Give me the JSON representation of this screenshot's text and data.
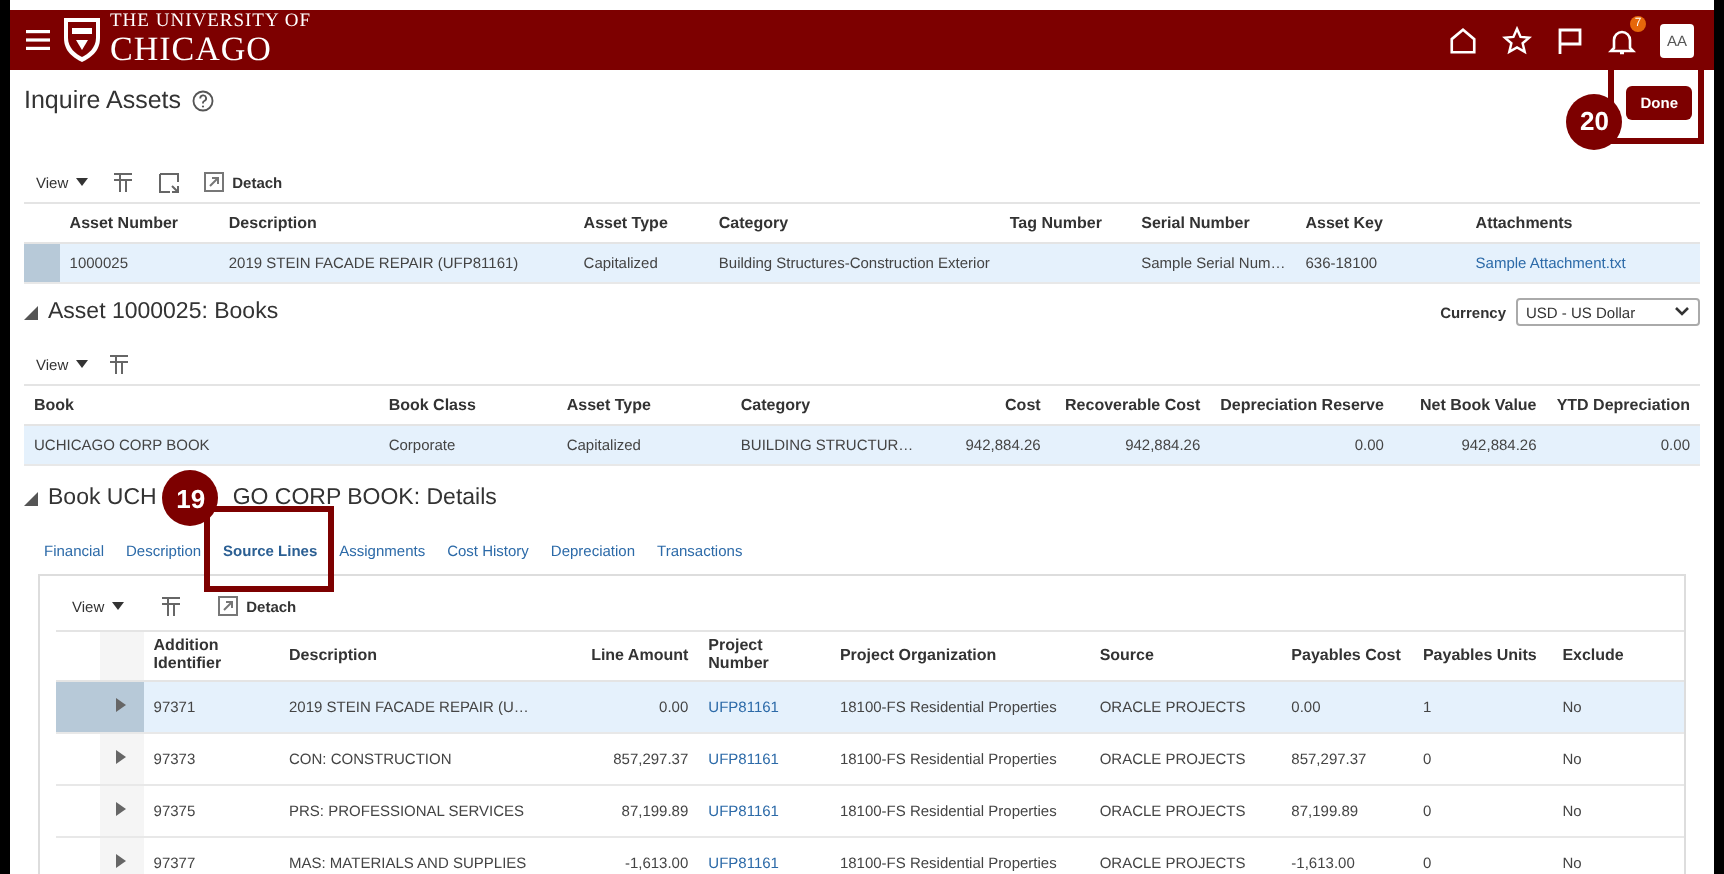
{
  "header": {
    "logo_top": "THE UNIVERSITY OF",
    "logo_bottom": "CHICAGO",
    "notification_count": "7",
    "avatar": "AA"
  },
  "page": {
    "title": "Inquire Assets",
    "done_button": "Done",
    "done_callout": "20"
  },
  "assets_toolbar": {
    "view": "View",
    "detach": "Detach"
  },
  "assets_table": {
    "columns": [
      "Asset Number",
      "Description",
      "Asset Type",
      "Category",
      "Tag Number",
      "Serial Number",
      "Asset Key",
      "Attachments"
    ],
    "rows": [
      {
        "selected": true,
        "cells": [
          "1000025",
          "2019 STEIN FACADE REPAIR (UFP81161)",
          "Capitalized",
          "Building Structures-Construction Exterior",
          "",
          "Sample Serial Num…",
          "636-18100",
          "Sample Attachment.txt"
        ]
      }
    ]
  },
  "books_section": {
    "title": "Asset 1000025: Books",
    "currency_label": "Currency",
    "currency_value": "USD - US Dollar",
    "view": "View"
  },
  "books_table": {
    "columns": [
      "Book",
      "Book Class",
      "Asset Type",
      "Category",
      "Cost",
      "Recoverable Cost",
      "Depreciation Reserve",
      "Net Book Value",
      "YTD Depreciation"
    ],
    "rows": [
      {
        "selected": true,
        "cells": [
          "UCHICAGO CORP BOOK",
          "Corporate",
          "Capitalized",
          "BUILDING STRUCTUR…",
          "942,884.26",
          "942,884.26",
          "0.00",
          "942,884.26",
          "0.00"
        ]
      }
    ]
  },
  "details_section": {
    "title_visible_parts": [
      "Book UCH",
      "GO CORP BOOK: Details"
    ]
  },
  "tabs": [
    {
      "label": "Financial",
      "selected": false
    },
    {
      "label": "Description",
      "selected": false
    },
    {
      "label": "Source Lines",
      "selected": true,
      "callout": "19"
    },
    {
      "label": "Assignments",
      "selected": false
    },
    {
      "label": "Cost History",
      "selected": false
    },
    {
      "label": "Depreciation",
      "selected": false
    },
    {
      "label": "Transactions",
      "selected": false
    }
  ],
  "source_toolbar": {
    "view": "View",
    "detach": "Detach"
  },
  "source_table": {
    "columns": [
      "Addition Identifier",
      "Description",
      "Line Amount",
      "Project Number",
      "Project Organization",
      "Source",
      "Payables Cost",
      "Payables Units",
      "Exclude"
    ],
    "rows": [
      {
        "selected": true,
        "cells": [
          "97371",
          "2019 STEIN FACADE REPAIR (U…",
          "0.00",
          "UFP81161",
          "18100-FS Residential Properties",
          "ORACLE PROJECTS",
          "0.00",
          "1",
          "No"
        ]
      },
      {
        "selected": false,
        "cells": [
          "97373",
          "CON: CONSTRUCTION",
          "857,297.37",
          "UFP81161",
          "18100-FS Residential Properties",
          "ORACLE PROJECTS",
          "857,297.37",
          "0",
          "No"
        ]
      },
      {
        "selected": false,
        "cells": [
          "97375",
          "PRS: PROFESSIONAL SERVICES",
          "87,199.89",
          "UFP81161",
          "18100-FS Residential Properties",
          "ORACLE PROJECTS",
          "87,199.89",
          "0",
          "No"
        ]
      },
      {
        "selected": false,
        "cells": [
          "97377",
          "MAS: MATERIALS AND SUPPLIES",
          "-1,613.00",
          "UFP81161",
          "18100-FS Residential Properties",
          "ORACLE PROJECTS",
          "-1,613.00",
          "0",
          "No"
        ]
      }
    ]
  }
}
